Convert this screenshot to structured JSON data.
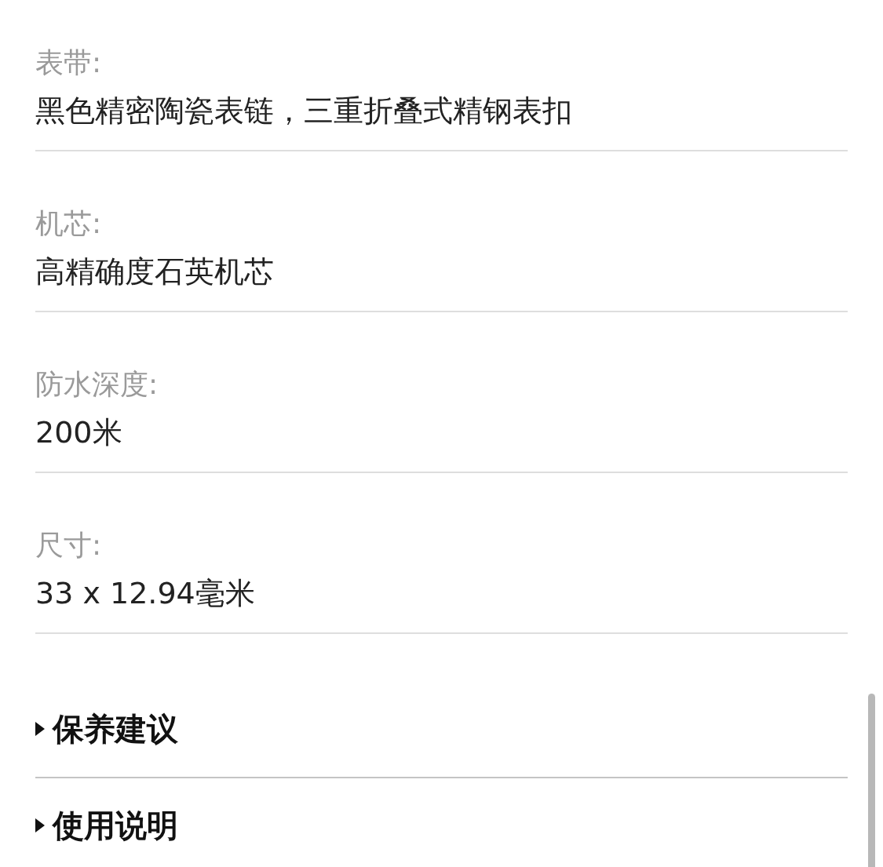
{
  "specs": [
    {
      "label": "表带:",
      "value": "黑色精密陶瓷表链，三重折叠式精钢表扣"
    },
    {
      "label": "机芯:",
      "value": "高精确度石英机芯"
    },
    {
      "label": "防水深度:",
      "value": "200米"
    },
    {
      "label": "尺寸:",
      "value": "33 x 12.94毫米"
    }
  ],
  "sections": [
    {
      "title": "保养建议",
      "expanded": false
    },
    {
      "title": "使用说明",
      "expanded": false
    }
  ]
}
